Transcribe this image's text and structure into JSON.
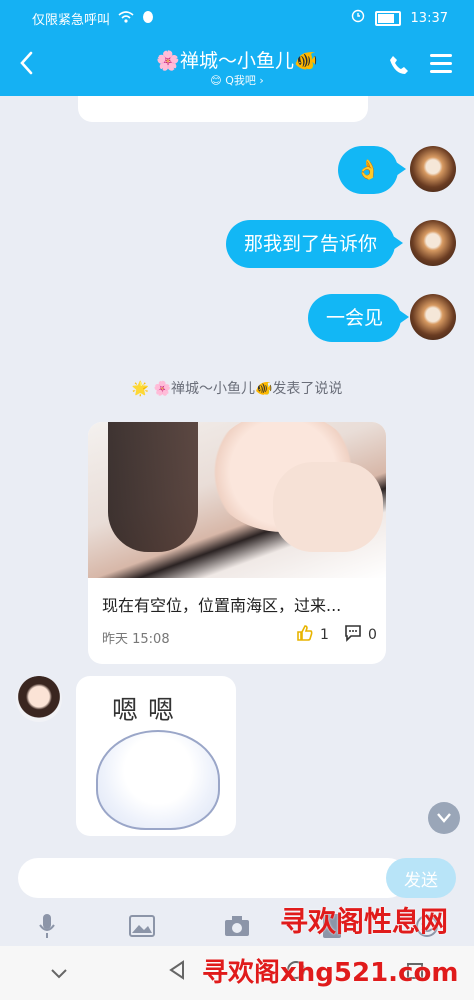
{
  "status_bar": {
    "carrier_text": "仅限紧急呼叫",
    "time": "13:37"
  },
  "header": {
    "title": "🌸禅城～小鱼儿🐠",
    "subtitle": "😊 Q我吧 ›"
  },
  "messages": [
    {
      "text": "👌"
    },
    {
      "text": "那我到了告诉你"
    },
    {
      "text": "一会见"
    }
  ],
  "feed_notice": "🌟 🌸禅城～小鱼儿🐠发表了说说",
  "post": {
    "text": "现在有空位，位置南海区，过来...",
    "time": "昨天 15:08",
    "likes": "1",
    "comments": "0"
  },
  "sticker": {
    "text": "嗯嗯"
  },
  "input": {
    "placeholder": "",
    "send_label": "发送"
  },
  "watermark": {
    "line1": "寻欢阁性息网",
    "line2": "寻欢阁xhg521.com"
  },
  "colors": {
    "accent": "#12b7f5",
    "header": "#15b1f3"
  }
}
